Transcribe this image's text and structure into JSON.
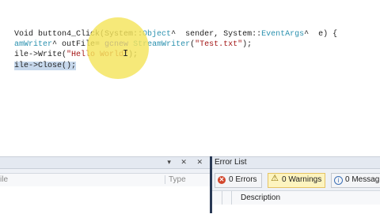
{
  "editor": {
    "lines": [
      {
        "a": "Void button4_Click(System::",
        "b": "Object",
        "c": "^  sender, System::",
        "d": "EventArgs",
        "e": "^  e) {"
      },
      {
        "a": "amWriter",
        "b": "^ outFile= ",
        "c": "gcnew",
        "d": " StreamWriter",
        "e": "(",
        "f": "\"Test.txt\"",
        "g": ");"
      },
      {
        "a": "ile->Write(",
        "b": "\"Hello World\"",
        "c": ");"
      },
      {
        "a": "ile->Close();"
      }
    ]
  },
  "left_panel": {
    "col_name": "ile",
    "col_type": "Type",
    "buttons": "▾ ✕ ✕"
  },
  "error_list": {
    "title": "Error List",
    "errors": "0 Errors",
    "warnings": "0 Warnings",
    "messages": "0 Messag",
    "col_description": "Description",
    "icons": [
      "error-circle-icon",
      "warning-triangle-icon",
      "info-circle-icon"
    ]
  }
}
